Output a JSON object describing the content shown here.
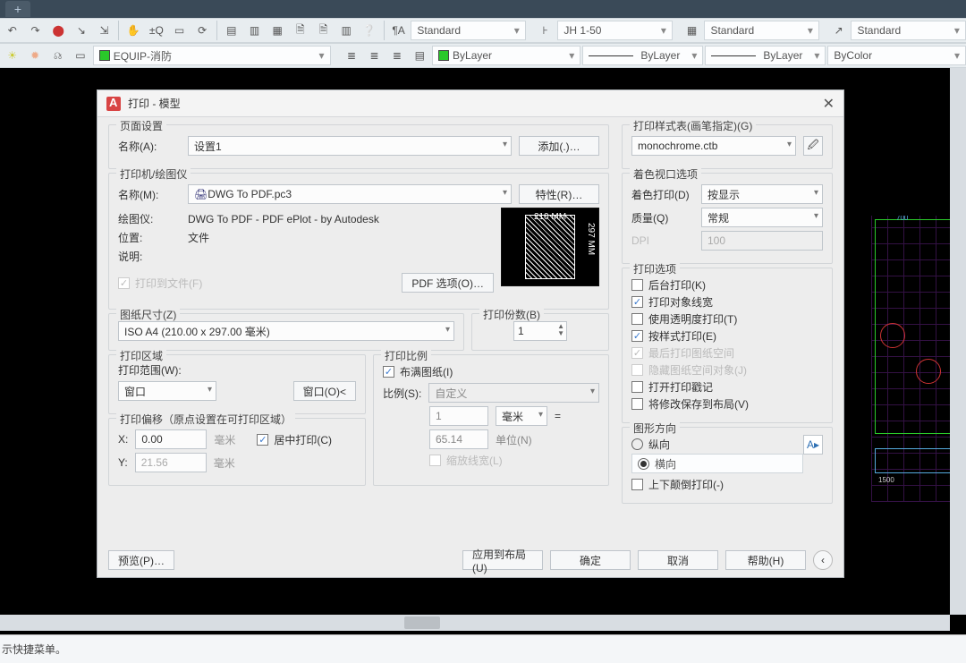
{
  "toolbar": {
    "style_text": "Standard",
    "style_dim": "JH 1-50",
    "style_table": "Standard",
    "style_ml": "Standard",
    "layer": "EQUIP-消防",
    "by_layer_line": "ByLayer",
    "by_layer_weight": "ByLayer",
    "by_color": "ByColor"
  },
  "dialog": {
    "title": "打印 - 模型",
    "page_setup": {
      "title": "页面设置",
      "name_label": "名称(A):",
      "name_value": "设置1",
      "add_btn": "添加(.)…"
    },
    "printer": {
      "title": "打印机/绘图仪",
      "name_label": "名称(M):",
      "name_value": "DWG To PDF.pc3",
      "props_btn": "特性(R)…",
      "plotter_label": "绘图仪:",
      "plotter_value": "DWG To PDF - PDF ePlot - by Autodesk",
      "location_label": "位置:",
      "location_value": "文件",
      "desc_label": "说明:",
      "print_to_file": "打印到文件(F)",
      "pdf_options_btn": "PDF 选项(O)…",
      "preview_w": "210 MM",
      "preview_h": "297 MM"
    },
    "paper": {
      "title": "图纸尺寸(Z)",
      "value": "ISO A4 (210.00 x 297.00 毫米)"
    },
    "copies": {
      "title": "打印份数(B)",
      "value": "1"
    },
    "area": {
      "title": "打印区域",
      "range_label": "打印范围(W):",
      "range_value": "窗口",
      "window_btn": "窗口(O)<"
    },
    "scale": {
      "title": "打印比例",
      "fit": "布满图纸(I)",
      "ratio_label": "比例(S):",
      "ratio_value": "自定义",
      "unit1": "1",
      "unit1_lbl": "毫米",
      "eq": "=",
      "unit2": "65.14",
      "unit2_lbl": "单位(N)",
      "scale_lw": "缩放线宽(L)"
    },
    "offset": {
      "title": "打印偏移（原点设置在可打印区域）",
      "x_label": "X:",
      "x_value": "0.00",
      "x_unit": "毫米",
      "y_label": "Y:",
      "y_value": "21.56",
      "y_unit": "毫米",
      "center": "居中打印(C)"
    },
    "styletable": {
      "title": "打印样式表(画笔指定)(G)",
      "value": "monochrome.ctb"
    },
    "shadeopts": {
      "title": "着色视口选项",
      "plot_label": "着色打印(D)",
      "plot_value": "按显示",
      "quality_label": "质量(Q)",
      "quality_value": "常规",
      "dpi_label": "DPI",
      "dpi_value": "100"
    },
    "options": {
      "title": "打印选项",
      "items": [
        {
          "label": "后台打印(K)",
          "checked": false,
          "disabled": false
        },
        {
          "label": "打印对象线宽",
          "checked": true,
          "disabled": false
        },
        {
          "label": "使用透明度打印(T)",
          "checked": false,
          "disabled": false
        },
        {
          "label": "按样式打印(E)",
          "checked": true,
          "disabled": false
        },
        {
          "label": "最后打印图纸空间",
          "checked": true,
          "disabled": true
        },
        {
          "label": "隐藏图纸空间对象(J)",
          "checked": false,
          "disabled": true
        },
        {
          "label": "打开打印戳记",
          "checked": false,
          "disabled": false
        },
        {
          "label": "将修改保存到布局(V)",
          "checked": false,
          "disabled": false
        }
      ]
    },
    "orientation": {
      "title": "图形方向",
      "portrait": "纵向",
      "landscape": "横向",
      "upside": "上下颠倒打印(-)"
    },
    "footer": {
      "preview": "预览(P)…",
      "apply": "应用到布局(U)",
      "ok": "确定",
      "cancel": "取消",
      "help": "帮助(H)"
    }
  },
  "cmdline": "示快捷菜单。"
}
